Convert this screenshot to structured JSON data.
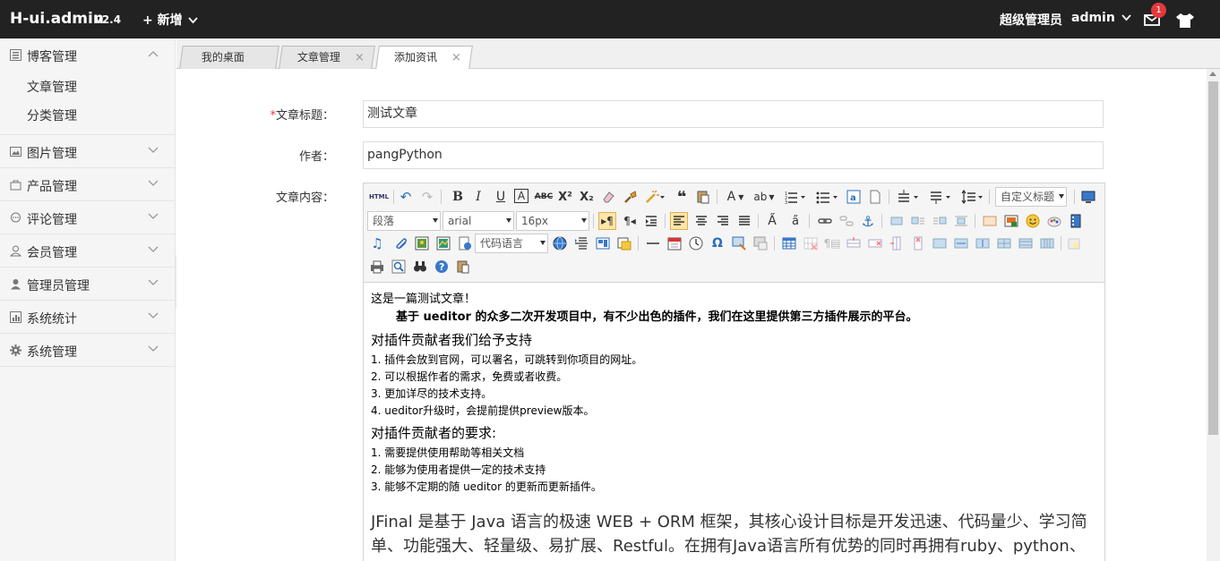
{
  "topbar": {
    "logo": "H-ui.admin",
    "version": "v2.4",
    "add_label": "新增",
    "user_role": "超级管理员",
    "user_name": "admin",
    "msg_count": "1"
  },
  "sidebar": {
    "groups": [
      {
        "label": "博客管理",
        "icon": "list-icon",
        "items": [
          "文章管理",
          "分类管理"
        ]
      },
      {
        "label": "图片管理",
        "icon": "picture-icon"
      },
      {
        "label": "产品管理",
        "icon": "bag-icon"
      },
      {
        "label": "评论管理",
        "icon": "comment-icon"
      },
      {
        "label": "会员管理",
        "icon": "user-icon"
      },
      {
        "label": "管理员管理",
        "icon": "admin-icon"
      },
      {
        "label": "系统统计",
        "icon": "chart-icon"
      },
      {
        "label": "系统管理",
        "icon": "gear-icon"
      }
    ]
  },
  "tabs": [
    {
      "label": "我的桌面"
    },
    {
      "label": "文章管理"
    },
    {
      "label": "添加资讯"
    }
  ],
  "form": {
    "title_label": "文章标题：",
    "title_required": "*",
    "title_value": "测试文章",
    "author_label": "作者：",
    "author_value": "pangPython",
    "content_label": "文章内容："
  },
  "editor": {
    "para_select": "段落",
    "font_select": "arial",
    "size_select": "16px",
    "custom_title_select": "自定义标题",
    "code_lang_select": "代码语言",
    "html_label": "HTML"
  },
  "doc": {
    "line1": "这是一篇测试文章！",
    "line2": "基于 ueditor 的众多二次开发项目中，有不少出色的插件，我们在这里提供第三方插件展示的平台。",
    "h1": "对插件贡献者我们给予支持",
    "list1": [
      "1. 插件会放到官网，可以署名，可跳转到你项目的网址。",
      "2. 可以根据作者的需求，免费或者收费。",
      "3. 更加详尽的技术支持。",
      "4. ueditor升级时，会提前提供preview版本。"
    ],
    "h2": "对插件贡献者的要求:",
    "list2": [
      "1. 需要提供使用帮助等相关文档",
      "2. 能够为使用者提供一定的技术支持",
      "3. 能够不定期的随 ueditor 的更新而更新插件。"
    ],
    "big": "JFinal 是基于 Java 语言的极速 WEB + ORM 框架，其核心设计目标是开发迅速、代码量少、学习简单、功能强大、轻量级、易扩展、Restful。在拥有Java语言所有优势的同时再拥有ruby、python、php等动态语言的开发效率！为您节约更多时间，去陪恋人、家人和朋友 ;)"
  }
}
